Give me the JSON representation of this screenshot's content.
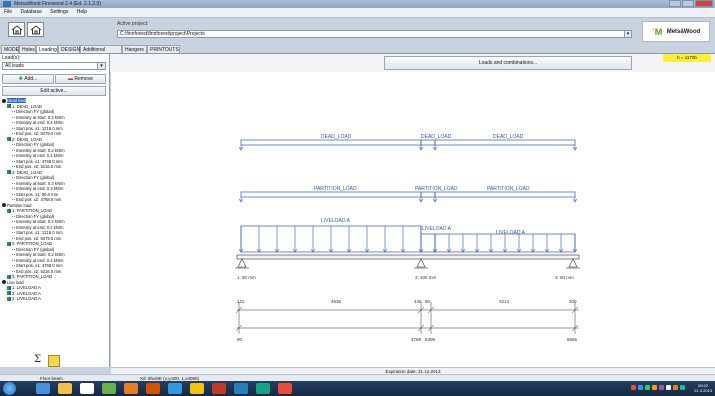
{
  "window": {
    "title": "MetsaWood Finnwood 2.4 (Ed. 2.1.2.0)"
  },
  "menu": [
    "File",
    "Database",
    "Settings",
    "Help"
  ],
  "project": {
    "label": "Active project:",
    "path": "C:\\finnforest\\finnforest\\project\\Projects"
  },
  "brand": {
    "mark": "ˈM",
    "name": "MetsäWood"
  },
  "tabs": [
    "MODEL",
    "Holes",
    "Loading",
    "DESIGN",
    "Additional results",
    "Hangers",
    "PRINTOUTS"
  ],
  "active_tab": "Loading",
  "left": {
    "loads_label": "Load(s):",
    "loads_select": "All loads",
    "add": "Add...",
    "remove": "Remove",
    "edit": "Edit active...",
    "tree": [
      {
        "indent": 0,
        "text": "Dead load",
        "kind": "group",
        "selected": true
      },
      {
        "indent": 1,
        "text": "1: DEAD_LOAD",
        "kind": "load"
      },
      {
        "indent": 2,
        "text": "Direction FY (global)",
        "kind": "leaf"
      },
      {
        "indent": 2,
        "text": "Intensity at start: 0.2 kN/m",
        "kind": "leaf"
      },
      {
        "indent": 2,
        "text": "Intensity at end: 0.2 kN/m",
        "kind": "leaf"
      },
      {
        "indent": 2,
        "text": "Start pos. x1: 1218.0 mm",
        "kind": "leaf"
      },
      {
        "indent": 2,
        "text": "End pos. x2: 8479.0 mm",
        "kind": "leaf"
      },
      {
        "indent": 1,
        "text": "2: DEAD_LOAD",
        "kind": "load"
      },
      {
        "indent": 2,
        "text": "Direction FY (global)",
        "kind": "leaf"
      },
      {
        "indent": 2,
        "text": "Intensity at start: 0.2 kN/m",
        "kind": "leaf"
      },
      {
        "indent": 2,
        "text": "Intensity at end: 0.2 kN/m",
        "kind": "leaf"
      },
      {
        "indent": 2,
        "text": "Start pos. x1: 4768.0 mm",
        "kind": "leaf"
      },
      {
        "indent": 2,
        "text": "End pos. x2: 5216.0 mm",
        "kind": "leaf"
      },
      {
        "indent": 1,
        "text": "3: DEAD_LOAD",
        "kind": "load"
      },
      {
        "indent": 2,
        "text": "Direction FY (global)",
        "kind": "leaf"
      },
      {
        "indent": 2,
        "text": "Intensity at start: 0.3 kN/m",
        "kind": "leaf"
      },
      {
        "indent": 2,
        "text": "Intensity at end: 0.3 kN/m",
        "kind": "leaf"
      },
      {
        "indent": 2,
        "text": "Start pos. x1: 90.0 mm",
        "kind": "leaf"
      },
      {
        "indent": 2,
        "text": "End pos. x2: 4768.0 mm",
        "kind": "leaf"
      },
      {
        "indent": 0,
        "text": "Partition load",
        "kind": "group"
      },
      {
        "indent": 1,
        "text": "1: PARTITION_LOAD",
        "kind": "load"
      },
      {
        "indent": 2,
        "text": "Direction FY (global)",
        "kind": "leaf"
      },
      {
        "indent": 2,
        "text": "Intensity at start: 0.2 kN/m",
        "kind": "leaf"
      },
      {
        "indent": 2,
        "text": "Intensity at end: 0.2 kN/m",
        "kind": "leaf"
      },
      {
        "indent": 2,
        "text": "Start pos. x1: 1218.0 mm",
        "kind": "leaf"
      },
      {
        "indent": 2,
        "text": "End pos. x2: 8479.0 mm",
        "kind": "leaf"
      },
      {
        "indent": 1,
        "text": "2: PARTITION_LOAD",
        "kind": "load"
      },
      {
        "indent": 2,
        "text": "Direction FY (global)",
        "kind": "leaf"
      },
      {
        "indent": 2,
        "text": "Intensity at start: 0.2 kN/m",
        "kind": "leaf"
      },
      {
        "indent": 2,
        "text": "Intensity at end: 0.2 kN/m",
        "kind": "leaf"
      },
      {
        "indent": 2,
        "text": "Start pos. x1: 4768.0 mm",
        "kind": "leaf"
      },
      {
        "indent": 2,
        "text": "End pos. x2: 5216.0 mm",
        "kind": "leaf"
      },
      {
        "indent": 1,
        "text": "3: PARTITION_LOAD",
        "kind": "load"
      },
      {
        "indent": 0,
        "text": "Live load",
        "kind": "group"
      },
      {
        "indent": 1,
        "text": "1: LIVELOAD A",
        "kind": "load"
      },
      {
        "indent": 1,
        "text": "2: LIVELOAD A",
        "kind": "load"
      },
      {
        "indent": 1,
        "text": "3: LIVELOAD A",
        "kind": "load"
      }
    ],
    "formula": "Σ"
  },
  "toolbar": {
    "loads_button": "Loads and combinations...",
    "tag": "h = 1170b"
  },
  "diagram": {
    "rows": [
      {
        "labels": [
          "DEAD_LOAD",
          "DEAD_LOAD",
          "DEAD_LOAD"
        ]
      },
      {
        "labels": [
          "PARTITION_LOAD",
          "PARTITION_LOAD",
          "PARTITION_LOAD"
        ]
      },
      {
        "labels": [
          "LIVELOAD A",
          "LIVELOAD A",
          "LIVELOAD A"
        ]
      }
    ],
    "supports": [
      "1: 90 mm",
      "2: 100 mm",
      "3: 90 mm"
    ],
    "dims_top": [
      "122",
      "4636",
      "446",
      "90",
      "3213",
      "300"
    ],
    "dims_bottom": [
      "90",
      "4768",
      "5306",
      "8665"
    ]
  },
  "expiry": "Expiration date: 31.12.2013",
  "status": {
    "left": "Floor beam",
    "mid": "Xd: 8hul4E (x,y,600, 1,x4080)"
  },
  "clock": {
    "time": "09:22",
    "date": "21.3.2013"
  },
  "colors": {
    "selection": "#2a63c4",
    "diagram": "#3556b8",
    "yellow": "#ffef3c"
  }
}
